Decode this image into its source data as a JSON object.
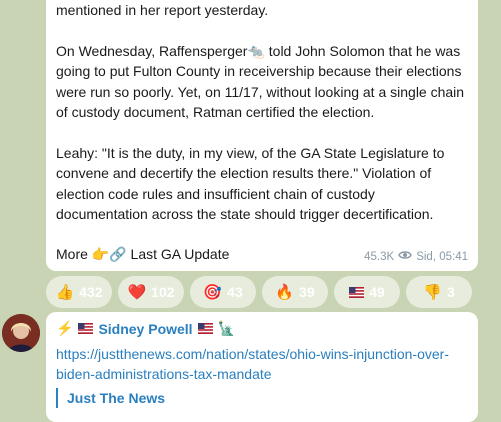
{
  "message1": {
    "paragraphs": [
      "mentioned in her report yesterday.",
      "On Wednesday, Raffensperger🐀 told John Solomon that he was going to put Fulton County in receivership because their elections were run so poorly. Yet, on 11/17, without looking at a single chain of custody document, Ratman certified the election.",
      "Leahy: \"It is the duty, in my view, of the GA State Legislature to convene and decertify the election results there.\" Violation of election code rules and insufficient chain of custody documentation across the state should trigger decertification."
    ],
    "footer_text": "More 👉🔗 Last GA Update",
    "views": "45.3K",
    "author_time": "Sid, 05:41",
    "icons": {
      "views": "eye-icon"
    }
  },
  "reactions": [
    {
      "emoji": "👍",
      "count": "432"
    },
    {
      "emoji": "❤️",
      "count": "102"
    },
    {
      "emoji": "🎯",
      "count": "43"
    },
    {
      "emoji": "🔥",
      "count": "39"
    },
    {
      "emoji": "🇺🇸",
      "count": "49"
    },
    {
      "emoji": "👎",
      "count": "3"
    }
  ],
  "message2": {
    "sender_prefix": "⚡",
    "sender_name": "Sidney Powell",
    "sender_suffix": "🗽",
    "link": "https://justthenews.com/nation/states/ohio-wins-injunction-over-biden-administrations-tax-mandate",
    "preview_site": "Just The News"
  },
  "colors": {
    "background": "#c9d4b4",
    "bubble": "#ffffff",
    "link": "#2a7fbf",
    "meta": "#8a9aa6"
  }
}
